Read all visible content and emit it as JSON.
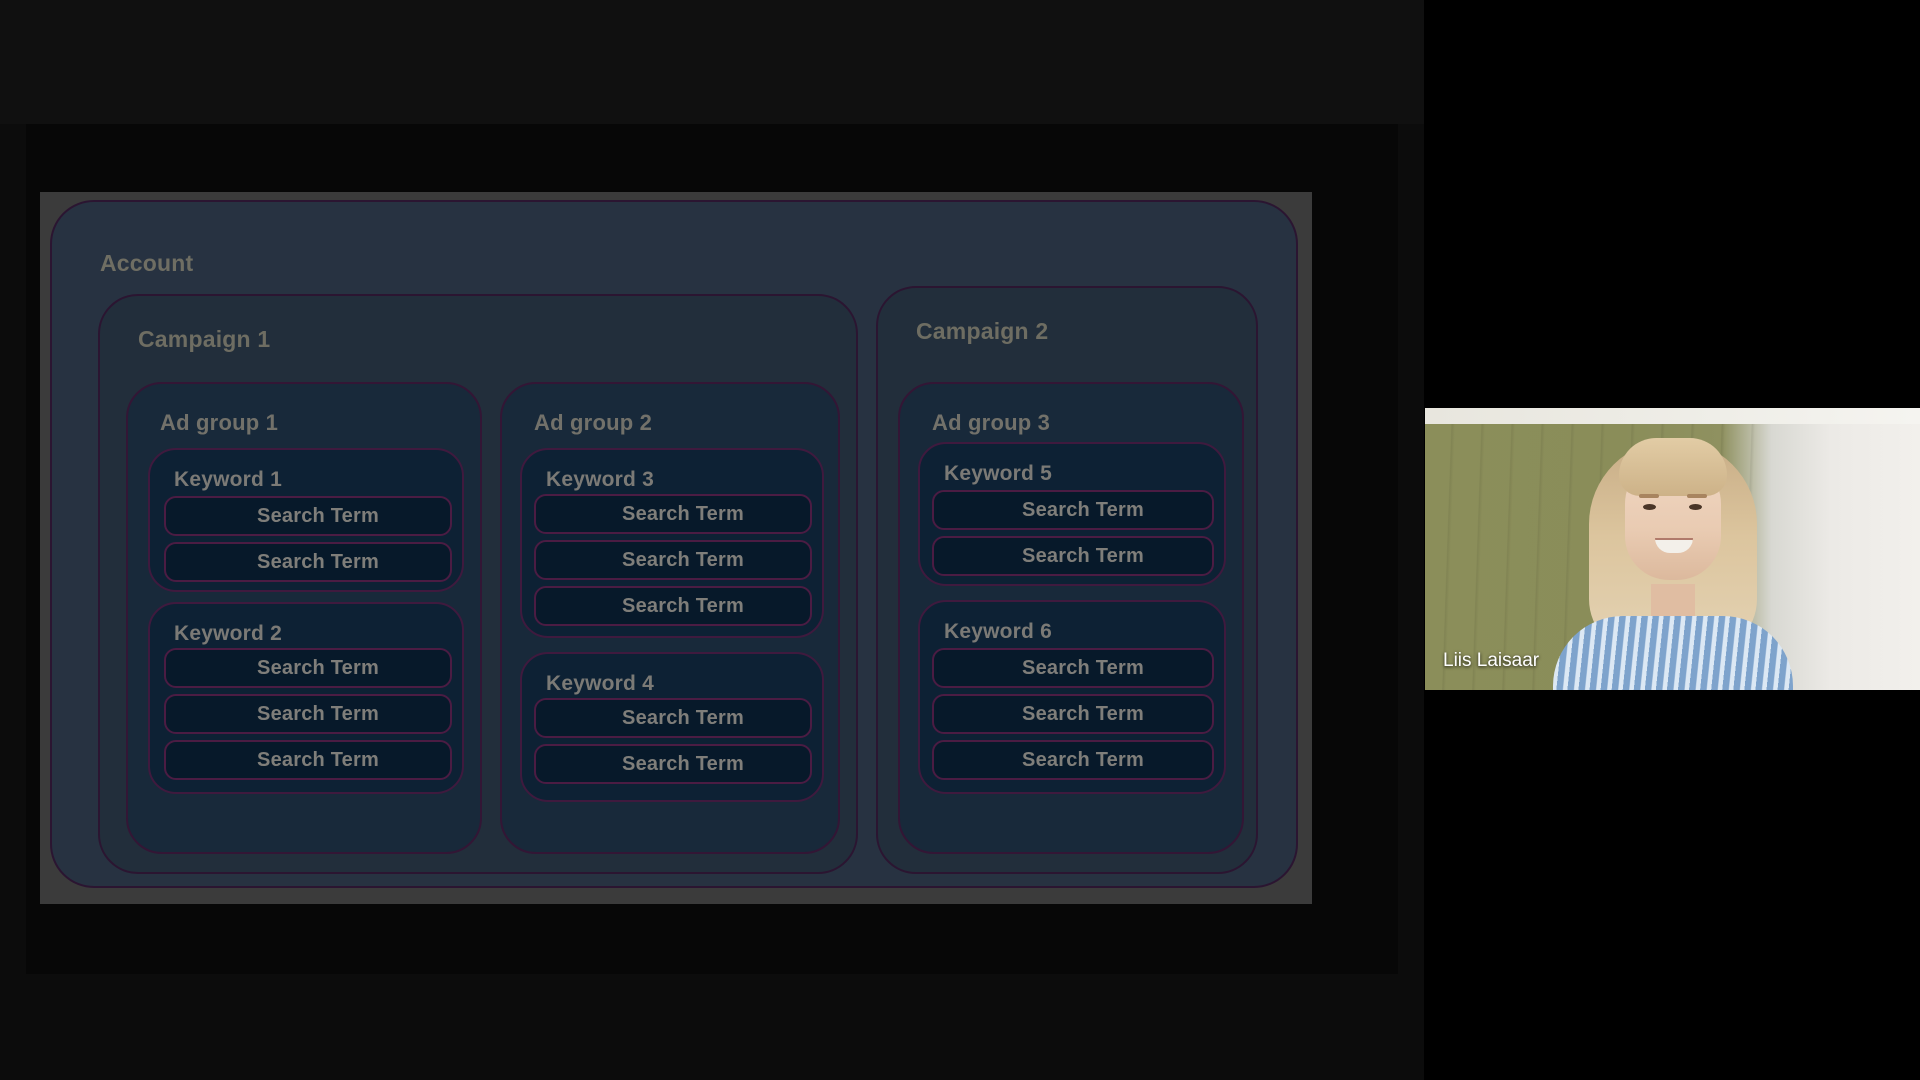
{
  "meeting": {
    "participant": {
      "name": "Liis Laisaar"
    }
  },
  "slide": {
    "account": {
      "label": "Account",
      "campaigns": [
        {
          "label": "Campaign 1",
          "ad_groups": [
            {
              "label": "Ad group 1",
              "keywords": [
                {
                  "label": "Keyword 1",
                  "search_terms": [
                    "Search Term",
                    "Search Term"
                  ]
                },
                {
                  "label": "Keyword 2",
                  "search_terms": [
                    "Search Term",
                    "Search Term",
                    "Search Term"
                  ]
                }
              ]
            },
            {
              "label": "Ad group 2",
              "keywords": [
                {
                  "label": "Keyword 3",
                  "search_terms": [
                    "Search Term",
                    "Search Term",
                    "Search Term"
                  ]
                },
                {
                  "label": "Keyword 4",
                  "search_terms": [
                    "Search Term",
                    "Search Term"
                  ]
                }
              ]
            }
          ]
        },
        {
          "label": "Campaign 2",
          "ad_groups": [
            {
              "label": "Ad group 3",
              "keywords": [
                {
                  "label": "Keyword 5",
                  "search_terms": [
                    "Search Term",
                    "Search Term"
                  ]
                },
                {
                  "label": "Keyword 6",
                  "search_terms": [
                    "Search Term",
                    "Search Term",
                    "Search Term"
                  ]
                }
              ]
            }
          ]
        }
      ]
    }
  },
  "colors": {
    "slide_background": "#3b3b3b",
    "account_fill": "#273241",
    "campaign_fill": "#222e3b",
    "adgroup_fill": "#18293a",
    "keyword_fill": "#0d2134",
    "term_fill": "#07192a",
    "border": "#2a1530",
    "label_text": "#6e6d62"
  }
}
